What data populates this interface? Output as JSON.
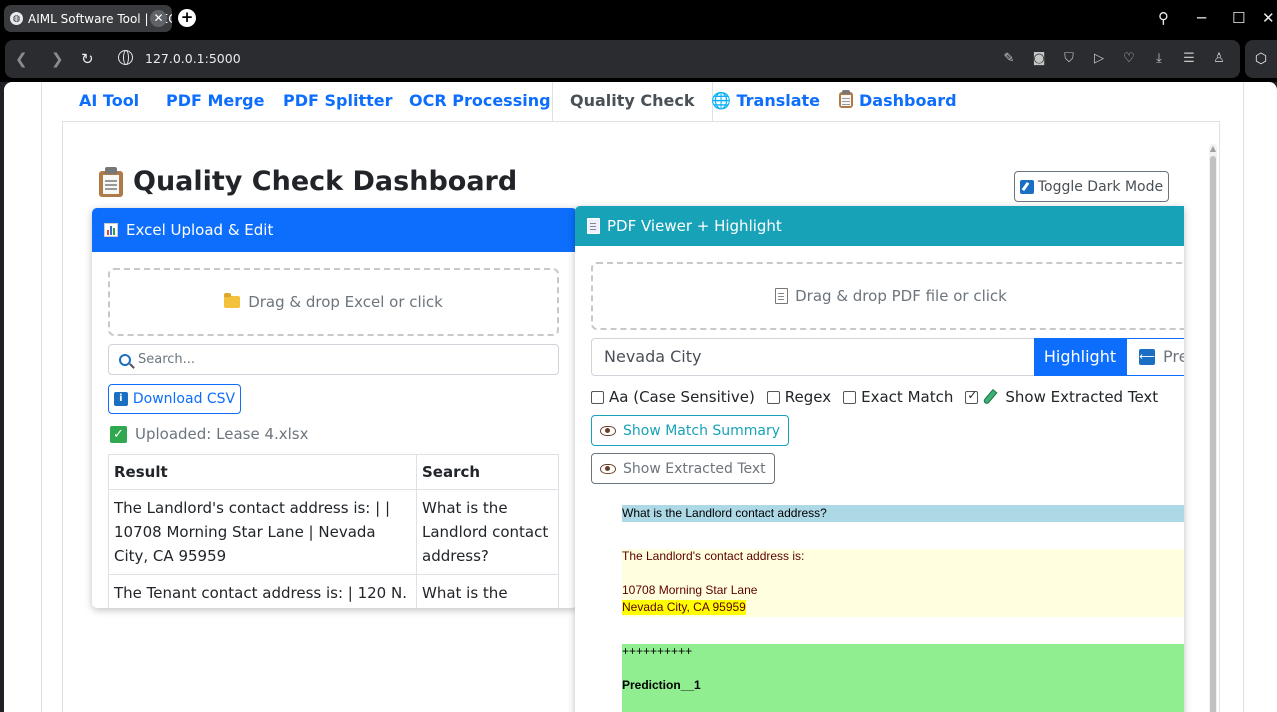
{
  "browser": {
    "tab_title": "AIML Software Tool | RECA",
    "url": "127.0.0.1:5000"
  },
  "nav": {
    "tabs": [
      {
        "label": "AI Tool"
      },
      {
        "label": "PDF Merge"
      },
      {
        "label": "PDF Splitter"
      },
      {
        "label": "OCR Processing"
      },
      {
        "label": "Quality Check"
      },
      {
        "label": "🌐 Translate"
      },
      {
        "label": "Dashboard"
      }
    ],
    "active": "Quality Check"
  },
  "dashboard": {
    "title": "Quality Check Dashboard",
    "dark_mode_label": "Toggle Dark Mode"
  },
  "excel": {
    "header": "Excel Upload & Edit",
    "dropzone": "Drag & drop Excel or click",
    "search_placeholder": "Search...",
    "download_label": "Download CSV",
    "uploaded": "Uploaded: Lease 4.xlsx",
    "columns": [
      "Result",
      "Search"
    ],
    "rows": [
      {
        "result": "The Landlord's contact address is: | | 10708 Morning Star Lane | Nevada City, CA 95959",
        "search": "What is the Landlord contact address?"
      },
      {
        "result": "The Tenant contact address is: | 120 N.",
        "search": "What is the Tenant"
      }
    ]
  },
  "pdf": {
    "header": "PDF Viewer + Highlight",
    "dropzone": "Drag & drop PDF file or click",
    "search_value": "Nevada City",
    "highlight_label": "Highlight",
    "prev_label": "Pre",
    "options": [
      {
        "label": "Aa (Case Sensitive)",
        "checked": false
      },
      {
        "label": "Regex",
        "checked": false
      },
      {
        "label": "Exact Match",
        "checked": false
      },
      {
        "label": "Show Extracted Text",
        "checked": true
      }
    ],
    "match_summary_label": "Show Match Summary",
    "show_text_label": "Show Extracted Text",
    "extract": {
      "question": "What is the Landlord contact address?",
      "answer_line1": "The Landlord's contact address is:",
      "answer_line2": "10708 Morning Star Lane",
      "answer_line3": "Nevada City, CA 95959",
      "pred_line1": "++++++++++",
      "pred_line2": "Prediction__1"
    }
  }
}
